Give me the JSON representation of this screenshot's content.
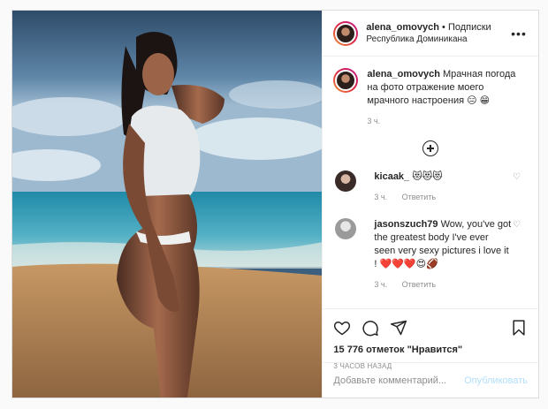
{
  "post": {
    "username": "alena_omovych",
    "follow_label": "Подписки",
    "location": "Республика Доминикана",
    "more_label": "•••"
  },
  "caption": {
    "username": "alena_omovych",
    "text": "Мрачная погода на фото отражение моего мрачного настроения",
    "emoji": "😑 😁",
    "time": "3 ч."
  },
  "comments": [
    {
      "username": "kicaak_",
      "text": "",
      "emoji": "😻😻😻",
      "time": "3 ч.",
      "reply_label": "Ответить"
    },
    {
      "username": "jasonszuch79",
      "text": "Wow, you've got the greatest body I've ever seen very sexy pictures i love it !",
      "emoji": "❤️❤️❤️😍🏈",
      "time": "3 ч.",
      "reply_label": "Ответить"
    }
  ],
  "likes_text": "15 776 отметок \"Нравится\"",
  "posted_ago": "3 ЧАСОВ НАЗАД",
  "add_comment": {
    "placeholder": "Добавьте комментарий...",
    "publish_label": "Опубликовать"
  }
}
